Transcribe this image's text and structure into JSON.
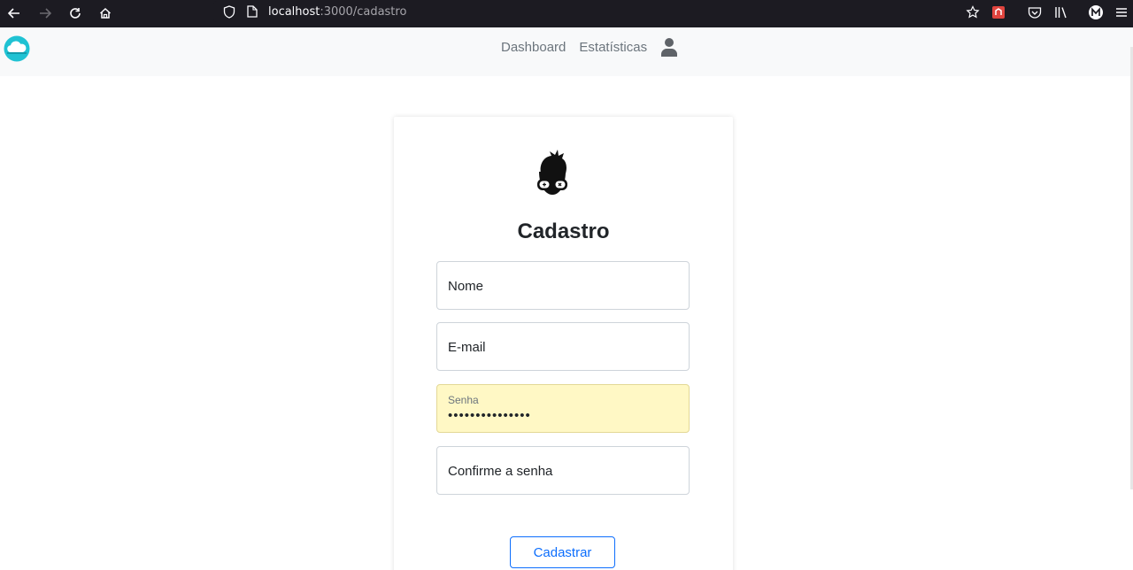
{
  "browser": {
    "url_host": "localhost",
    "url_path": ":3000/cadastro"
  },
  "navbar": {
    "links": [
      "Dashboard",
      "Estatísticas"
    ]
  },
  "form": {
    "title": "Cadastro",
    "fields": {
      "nome": {
        "placeholder": "Nome"
      },
      "email": {
        "placeholder": "E-mail"
      },
      "senha": {
        "label": "Senha",
        "value": "•••••••••••••••"
      },
      "confirm": {
        "placeholder": "Confirme a senha"
      }
    },
    "submit_label": "Cadastrar"
  },
  "colors": {
    "accent": "#0d6efd",
    "navbar_bg": "#f8f9fa",
    "autofill_bg": "#fff8c5",
    "logo_cloud": "#1fc2d3"
  }
}
